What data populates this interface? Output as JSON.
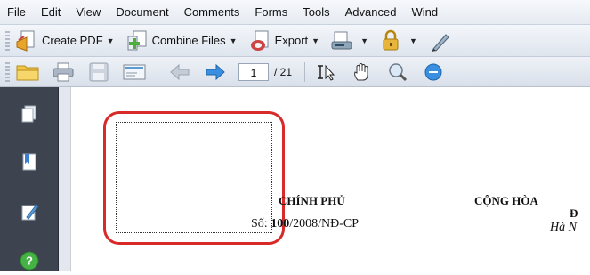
{
  "menu": [
    "File",
    "Edit",
    "View",
    "Document",
    "Comments",
    "Forms",
    "Tools",
    "Advanced",
    "Wind"
  ],
  "toolbar1": {
    "create_pdf": "Create PDF",
    "combine_files": "Combine Files",
    "export": "Export"
  },
  "toolbar2": {
    "page_current": "1",
    "page_total": "/ 21"
  },
  "document": {
    "agency": "CHÍNH PHỦ",
    "decree_prefix": "Số: ",
    "decree_number": "100",
    "decree_suffix": "/2008/NĐ-CP",
    "header_right": "CỘNG HÒA",
    "header_right2": "Đ",
    "place_date": "Hà N"
  },
  "colors": {
    "highlight": "#d92a2a",
    "sidebar": "#3d4450"
  }
}
